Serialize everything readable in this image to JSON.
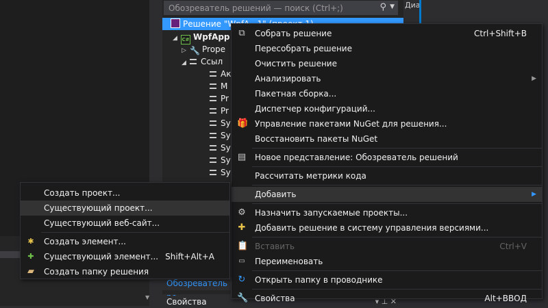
{
  "solution_explorer": {
    "search_placeholder": "Обозреватель решений — поиск (Ctrl+;)",
    "side_tab_label": "Диагн",
    "solution_label": "Решение \"WpfA...1\" (проект 1)",
    "project_label": "WpfApp",
    "tree": [
      {
        "label": "Prope",
        "arrow": "▷",
        "icon": "wrench-icon"
      },
      {
        "label": "Ссыл",
        "arrow": "◢",
        "icon": "references-icon"
      }
    ],
    "references": [
      "Ак",
      "М",
      "Pr",
      "Pr",
      "Sy",
      "Sy",
      "Sy",
      "Sy",
      "Sy"
    ],
    "bottom_tab": "Обозреватель ре"
  },
  "properties_panel": {
    "title": "Свойства",
    "buttons": "▾ ⊥ ✕"
  },
  "context_menu": {
    "items": [
      {
        "label": "Собрать решение",
        "shortcut": "Ctrl+Shift+B",
        "icon": "build-icon"
      },
      {
        "label": "Пересобрать решение"
      },
      {
        "label": "Очистить решение"
      },
      {
        "label": "Анализировать",
        "submenu": "▶"
      },
      {
        "label": "Пакетная сборка..."
      },
      {
        "label": "Диспетчер конфигураций..."
      },
      {
        "label": "Управление пакетами NuGet для решения...",
        "icon": "nuget-icon"
      },
      {
        "label": "Восстановить пакеты NuGet"
      },
      {
        "label": "Новое представление: Обозреватель решений",
        "icon": "new-view-icon"
      },
      {
        "label": "Рассчитать метрики кода"
      },
      {
        "label": "Добавить",
        "submenu": "▶"
      },
      {
        "label": "Назначить запускаемые проекты...",
        "icon": "gear-icon"
      },
      {
        "label": "Добавить решение в систему управления версиями...",
        "icon": "source-control-icon"
      },
      {
        "label": "Вставить",
        "shortcut": "Ctrl+V",
        "icon": "paste-icon"
      },
      {
        "label": "Переименовать",
        "icon": "rename-icon"
      },
      {
        "label": "Открыть папку в проводнике",
        "icon": "refresh-icon"
      },
      {
        "label": "Свойства",
        "shortcut": "Alt+ВВОД",
        "icon": "wrench-icon"
      }
    ]
  },
  "add_submenu": {
    "items": [
      {
        "label": "Создать проект..."
      },
      {
        "label": "Существующий проект..."
      },
      {
        "label": "Существующий веб-сайт..."
      },
      {
        "label": "Создать элемент...",
        "icon": "new-item-icon"
      },
      {
        "label": "Существующий элемент...",
        "shortcut": "Shift+Alt+A",
        "icon": "existing-item-icon"
      },
      {
        "label": "Создать папку решения",
        "icon": "folder-icon"
      }
    ]
  },
  "colors": {
    "accent": "#3399ff",
    "menu_bg": "#1b1b1c",
    "highlight": "#333334",
    "disabled_text": "#656565"
  }
}
